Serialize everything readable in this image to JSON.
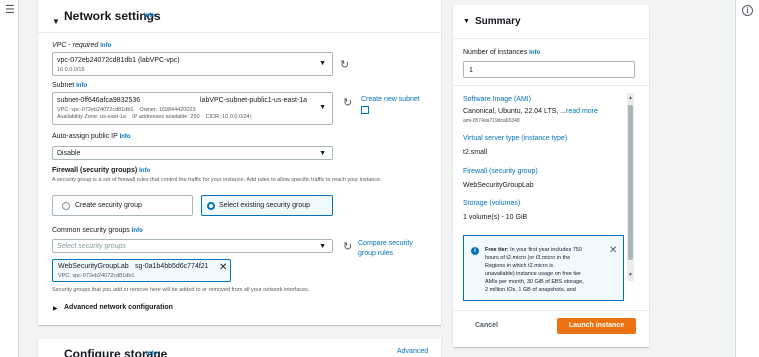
{
  "network": {
    "title": "Network settings",
    "info": "Info",
    "vpc_label": "VPC - required",
    "vpc_info": "Info",
    "vpc_value": "vpc-072eb24072cd81db1 (labVPC-vpc)",
    "vpc_cidr": "10.0.0.0/16",
    "subnet_label": "Subnet",
    "subnet_info": "Info",
    "subnet_id": "subnet-0ff646afca9832536",
    "subnet_name": "labVPC-subnet-public1-us-east-1a",
    "subnet_meta1": "VPC: vpc-072eb24072cd81db1    Owner: 169844420023",
    "subnet_meta2": "Availability Zone: us-east-1a    IP addresses available: 250    CIDR: 10.0.0.0/24)",
    "create_subnet": "Create new subnet",
    "auto_ip_label": "Auto-assign public IP",
    "auto_ip_info": "Info",
    "auto_ip_value": "Disable",
    "firewall_label": "Firewall (security groups)",
    "firewall_info": "Info",
    "firewall_desc": "A security group is a set of firewall rules that control the traffic for your instance. Add rules to allow specific traffic to reach your instance.",
    "radio_create": "Create security group",
    "radio_existing": "Select existing security group",
    "common_sg_label": "Common security groups",
    "common_sg_info": "Info",
    "sg_placeholder": "Select security groups",
    "compare_rules": "Compare security group rules",
    "token_name": "WebSecurityGroupLab",
    "token_id": "sg-0a1b4bb5d6c774f21",
    "token_vpc": "VPC: vpc-072eb24072cd81db1",
    "sg_note": "Security groups that you add or remove here will be added to or removed from all your network interfaces.",
    "advanced_net": "Advanced network configuration"
  },
  "storage": {
    "title": "Configure storage",
    "info": "Info",
    "advanced": "Advanced"
  },
  "summary": {
    "title": "Summary",
    "num_label": "Number of instances",
    "num_info": "Info",
    "num_value": "1",
    "ami_label": "Software Image (AMI)",
    "ami_value": "Canonical, Ubuntu, 22.04 LTS, ...",
    "ami_read_more": "read more",
    "ami_id": "ami-0574da719dca65348",
    "type_label": "Virtual server type (instance type)",
    "type_value": "t2.small",
    "firewall_label": "Firewall (security group)",
    "firewall_value": "WebSecurityGroupLab",
    "storage_label": "Storage (volumes)",
    "storage_value": "1 volume(s) - 10 GiB",
    "tip_bold": "Free tier:",
    "tip_lines": [
      " In your first year includes 750",
      "hours of t2.micro (or t3.micro in the",
      "Regions in which t2.micro is",
      "unavailable) instance usage on free tier",
      "AMIs per month, 30 GiB of EBS storage,",
      "2 million IOs, 1 GB of snapshots, and"
    ],
    "cancel": "Cancel",
    "launch": "Launch instance"
  }
}
